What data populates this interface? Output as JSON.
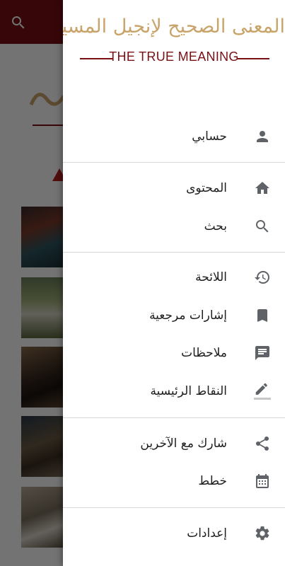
{
  "logo": {
    "arabic": "المعنى الصحيح لإنجيل المسيح",
    "english": "THE TRUE MEANING"
  },
  "menu": {
    "account": "حسابي",
    "content": "المحتوى",
    "search": "بحث",
    "history": "اللائحة",
    "bookmarks": "إشارات مرجعية",
    "notes": "ملاحظات",
    "highlights": "النقاط الرئيسية",
    "share": "شارك مع الآخرين",
    "plans": "خطط",
    "settings": "إعدادات"
  },
  "icons": {
    "account": "person-icon",
    "content": "home-icon",
    "search": "search-icon",
    "history": "history-icon",
    "bookmarks": "bookmark-icon",
    "notes": "chat-icon",
    "highlights": "pencil-icon",
    "share": "share-icon",
    "plans": "calendar-icon",
    "settings": "gear-icon"
  },
  "colors": {
    "brand": "#7a0f14",
    "gold": "#c9a46a",
    "icon": "#5f6368"
  }
}
